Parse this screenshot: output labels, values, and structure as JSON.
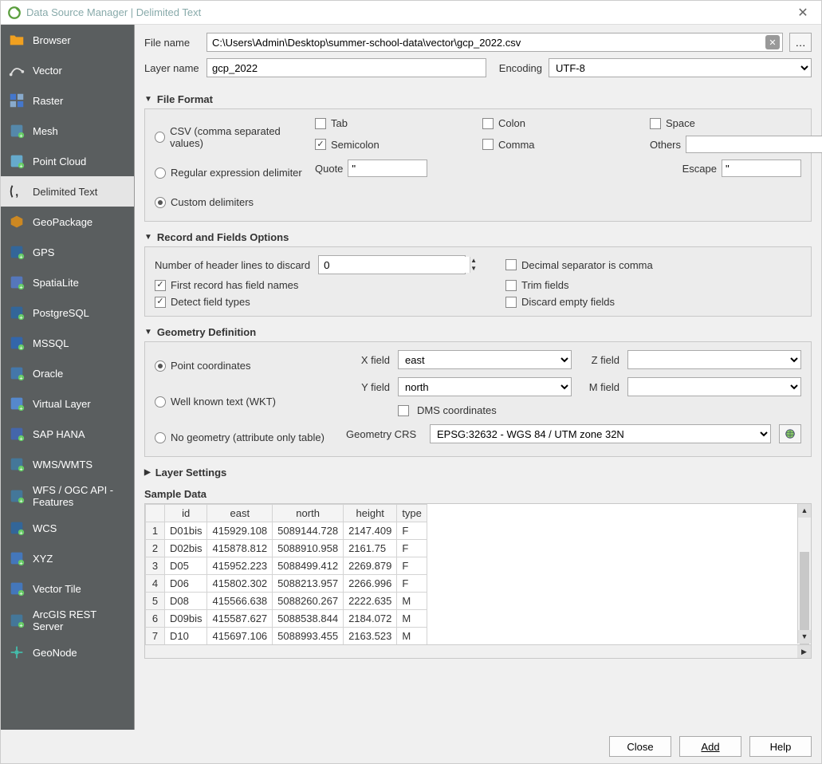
{
  "window": {
    "title": "Data Source Manager | Delimited Text"
  },
  "sidebar": {
    "items": [
      {
        "label": "Browser",
        "icon": "folder",
        "color": "#f0a020"
      },
      {
        "label": "Vector",
        "icon": "vector",
        "color": "#3a5fcd"
      },
      {
        "label": "Raster",
        "icon": "raster",
        "color": "#4477cc"
      },
      {
        "label": "Mesh",
        "icon": "mesh",
        "color": "#5588aa"
      },
      {
        "label": "Point Cloud",
        "icon": "pointcloud",
        "color": "#66aacc"
      },
      {
        "label": "Delimited Text",
        "icon": "delimited",
        "color": "#3366cc",
        "active": true
      },
      {
        "label": "GeoPackage",
        "icon": "geopackage",
        "color": "#cc8822"
      },
      {
        "label": "GPS",
        "icon": "gps",
        "color": "#336699"
      },
      {
        "label": "SpatiaLite",
        "icon": "spatialite",
        "color": "#5577bb"
      },
      {
        "label": "PostgreSQL",
        "icon": "postgresql",
        "color": "#336699"
      },
      {
        "label": "MSSQL",
        "icon": "mssql",
        "color": "#3366aa"
      },
      {
        "label": "Oracle",
        "icon": "oracle",
        "color": "#4477aa"
      },
      {
        "label": "Virtual Layer",
        "icon": "virtual",
        "color": "#5588cc"
      },
      {
        "label": "SAP HANA",
        "icon": "saphana",
        "color": "#4466aa"
      },
      {
        "label": "WMS/WMTS",
        "icon": "wms",
        "color": "#447799"
      },
      {
        "label": "WFS / OGC API - Features",
        "icon": "wfs",
        "color": "#447799"
      },
      {
        "label": "WCS",
        "icon": "wcs",
        "color": "#336699"
      },
      {
        "label": "XYZ",
        "icon": "xyz",
        "color": "#4477bb"
      },
      {
        "label": "Vector Tile",
        "icon": "vectortile",
        "color": "#4477bb"
      },
      {
        "label": "ArcGIS REST Server",
        "icon": "arcgis",
        "color": "#447799"
      },
      {
        "label": "GeoNode",
        "icon": "geonode",
        "color": "#44bbaa"
      }
    ]
  },
  "top": {
    "file_name_label": "File name",
    "file_name": "C:\\Users\\Admin\\Desktop\\summer-school-data\\vector\\gcp_2022.csv",
    "browse_label": "…",
    "layer_name_label": "Layer name",
    "layer_name": "gcp_2022",
    "encoding_label": "Encoding",
    "encoding": "UTF-8"
  },
  "file_format": {
    "title": "File Format",
    "csv_label": "CSV (comma separated values)",
    "regex_label": "Regular expression delimiter",
    "custom_label": "Custom delimiters",
    "selected": "custom",
    "delims": {
      "tab": {
        "label": "Tab",
        "checked": false
      },
      "colon": {
        "label": "Colon",
        "checked": false
      },
      "space": {
        "label": "Space",
        "checked": false
      },
      "semicolon": {
        "label": "Semicolon",
        "checked": true
      },
      "comma": {
        "label": "Comma",
        "checked": false
      }
    },
    "others_label": "Others",
    "others_value": "",
    "quote_label": "Quote",
    "quote_value": "\"",
    "escape_label": "Escape",
    "escape_value": "\""
  },
  "records": {
    "title": "Record and Fields Options",
    "header_lines_label": "Number of header lines to discard",
    "header_lines": "0",
    "decimal_comma": {
      "label": "Decimal separator is comma",
      "checked": false
    },
    "first_record": {
      "label": "First record has field names",
      "checked": true
    },
    "trim": {
      "label": "Trim fields",
      "checked": false
    },
    "detect": {
      "label": "Detect field types",
      "checked": true
    },
    "discard_empty": {
      "label": "Discard empty fields",
      "checked": false
    }
  },
  "geometry": {
    "title": "Geometry Definition",
    "point_label": "Point coordinates",
    "wkt_label": "Well known text (WKT)",
    "none_label": "No geometry (attribute only table)",
    "selected": "point",
    "x_label": "X field",
    "x_value": "east",
    "y_label": "Y field",
    "y_value": "north",
    "z_label": "Z field",
    "z_value": "",
    "m_label": "M field",
    "m_value": "",
    "dms": {
      "label": "DMS coordinates",
      "checked": false
    },
    "crs_label": "Geometry CRS",
    "crs_value": "EPSG:32632 - WGS 84 / UTM zone 32N"
  },
  "layer_settings": {
    "title": "Layer Settings"
  },
  "sample": {
    "title": "Sample Data",
    "headers": [
      "id",
      "east",
      "north",
      "height",
      "type"
    ],
    "rows": [
      [
        "1",
        "D01bis",
        "415929.108",
        "5089144.728",
        "2147.409",
        "F"
      ],
      [
        "2",
        "D02bis",
        "415878.812",
        "5088910.958",
        "2161.75",
        "F"
      ],
      [
        "3",
        "D05",
        "415952.223",
        "5088499.412",
        "2269.879",
        "F"
      ],
      [
        "4",
        "D06",
        "415802.302",
        "5088213.957",
        "2266.996",
        "F"
      ],
      [
        "5",
        "D08",
        "415566.638",
        "5088260.267",
        "2222.635",
        "M"
      ],
      [
        "6",
        "D09bis",
        "415587.627",
        "5088538.844",
        "2184.072",
        "M"
      ],
      [
        "7",
        "D10",
        "415697.106",
        "5088993.455",
        "2163.523",
        "M"
      ]
    ]
  },
  "footer": {
    "close": "Close",
    "add": "Add",
    "help": "Help"
  }
}
